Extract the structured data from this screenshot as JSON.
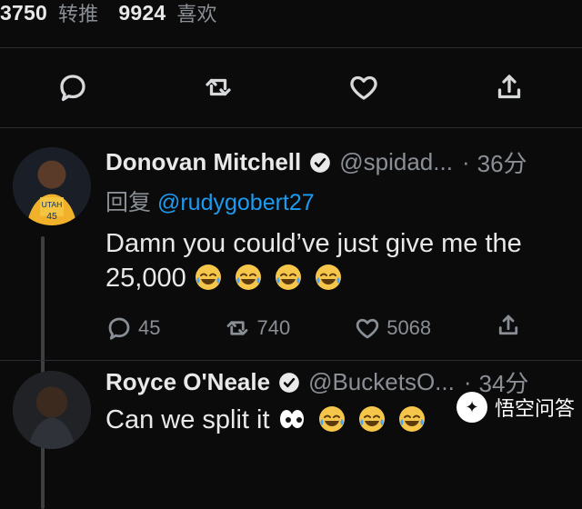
{
  "top_stats": {
    "retweets": "3750",
    "retweets_label": "转推",
    "likes": "9924",
    "likes_label": "喜欢"
  },
  "replies": [
    {
      "name": "Donovan Mitchell",
      "handle": "@spidad...",
      "dot": "·",
      "time": "36分",
      "reply_prefix": "回复",
      "reply_mention": "@rudygobert27",
      "text_line1": "Damn you could’ve just give me the",
      "text_line2": "25,000",
      "metrics": {
        "replies": "45",
        "retweets": "740",
        "likes": "5068"
      }
    },
    {
      "name": "Royce O'Neale",
      "handle": "@BucketsO...",
      "dot": "·",
      "time": "34分",
      "text_line1": "Can we split it"
    }
  ],
  "watermark": {
    "text": "悟空问答"
  },
  "colors": {
    "link": "#1d9bf0",
    "muted": "#8a8f95"
  }
}
